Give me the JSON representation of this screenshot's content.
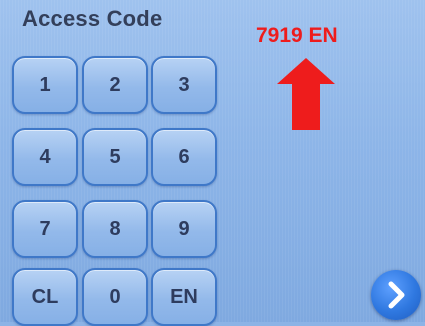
{
  "screen": {
    "title": "Access Code"
  },
  "keypad": {
    "keys": [
      "1",
      "2",
      "3",
      "4",
      "5",
      "6",
      "7",
      "8",
      "9",
      "CL",
      "0",
      "EN"
    ]
  },
  "annotation": {
    "text": "7919 EN",
    "color": "#ee1c1c",
    "icon": "arrow-up-icon"
  },
  "navigation": {
    "next_icon": "chevron-right-icon"
  }
}
